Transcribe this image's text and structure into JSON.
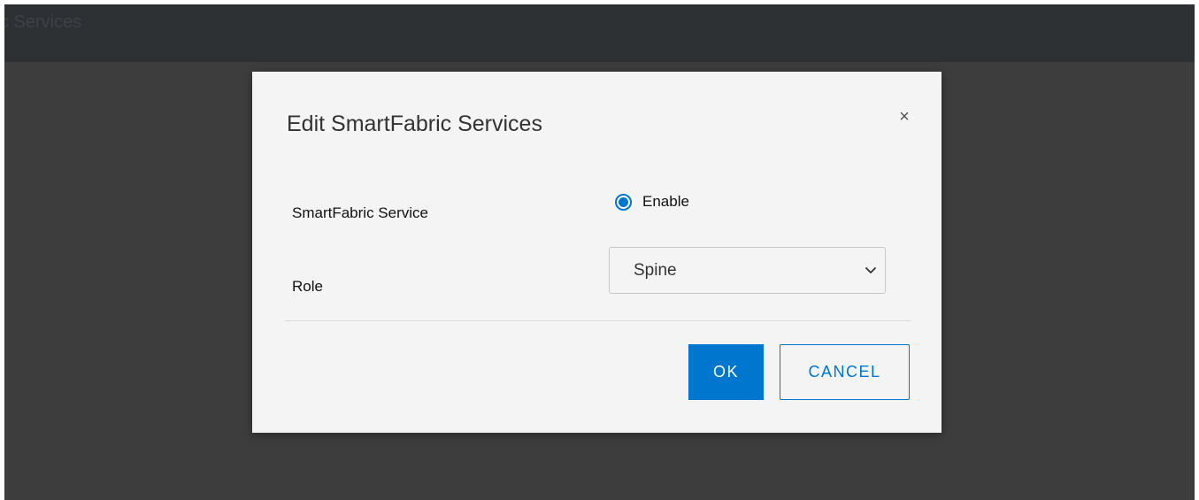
{
  "background": {
    "page_title_partial": "c Services"
  },
  "modal": {
    "title": "Edit SmartFabric Services",
    "close_icon": "×",
    "fields": {
      "smartfabric_service": {
        "label": "SmartFabric Service",
        "option_label": "Enable",
        "selected": true
      },
      "role": {
        "label": "Role",
        "value": "Spine"
      }
    },
    "buttons": {
      "ok_label": "OK",
      "cancel_label": "CANCEL"
    }
  },
  "colors": {
    "accent": "#0076ce",
    "overlay": "#3d3d3d",
    "header": "#2e3134",
    "modal_bg": "#f4f4f4"
  }
}
